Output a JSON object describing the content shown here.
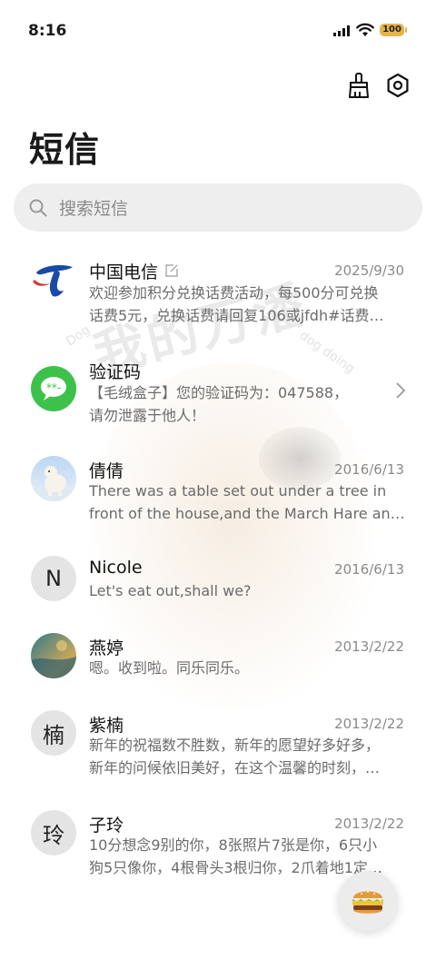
{
  "status_bar": {
    "time": "8:16",
    "battery": "100"
  },
  "header": {
    "title": "短信"
  },
  "search": {
    "placeholder": "搜索短信"
  },
  "watermark": {
    "main": "我的万潘",
    "left": "Dog",
    "right": "dog doing"
  },
  "messages": [
    {
      "name": "中国电信",
      "date": "2025/9/30",
      "line1": "欢迎参加积分兑换话费活动，每500分可兑换",
      "line2": "话费5元，兑换话费请回复106或jfdh#话费…"
    },
    {
      "name": "验证码",
      "date": "",
      "line1": "【毛绒盒子】您的验证码为：047588，",
      "line2": "请勿泄露于他人！"
    },
    {
      "name": "倩倩",
      "date": "2016/6/13",
      "line1": "There was a table set out under a tree in",
      "line2": "front of the house,and the March Hare an…"
    },
    {
      "name": "Nicole",
      "date": "2016/6/13",
      "avatar_letter": "N",
      "line1": "Let's eat out,shall we?"
    },
    {
      "name": "燕婷",
      "date": "2013/2/22",
      "line1": "嗯。收到啦。同乐同乐。"
    },
    {
      "name": "紫楠",
      "date": "2013/2/22",
      "avatar_letter": "楠",
      "line1": "新年的祝福数不胜数，新年的愿望好多好多，",
      "line2": "新年的问候依旧美好，在这个温馨的时刻，…"
    },
    {
      "name": "子玲",
      "date": "2013/2/22",
      "avatar_letter": "玲",
      "line1": "10分想念9别的你，8张照片7张是你，6只小",
      "line2": "狗5只像你，4根骨头3根归你，2爪着地1定…"
    }
  ],
  "icons": {
    "clean": "broom-icon",
    "settings": "settings-hexagon-icon",
    "search": "search-icon",
    "compose": "burger-emoji-icon"
  },
  "colors": {
    "telecom_blue": "#1a4aa8",
    "verify_green": "#3cc24b",
    "battery": "#e8b34a"
  }
}
